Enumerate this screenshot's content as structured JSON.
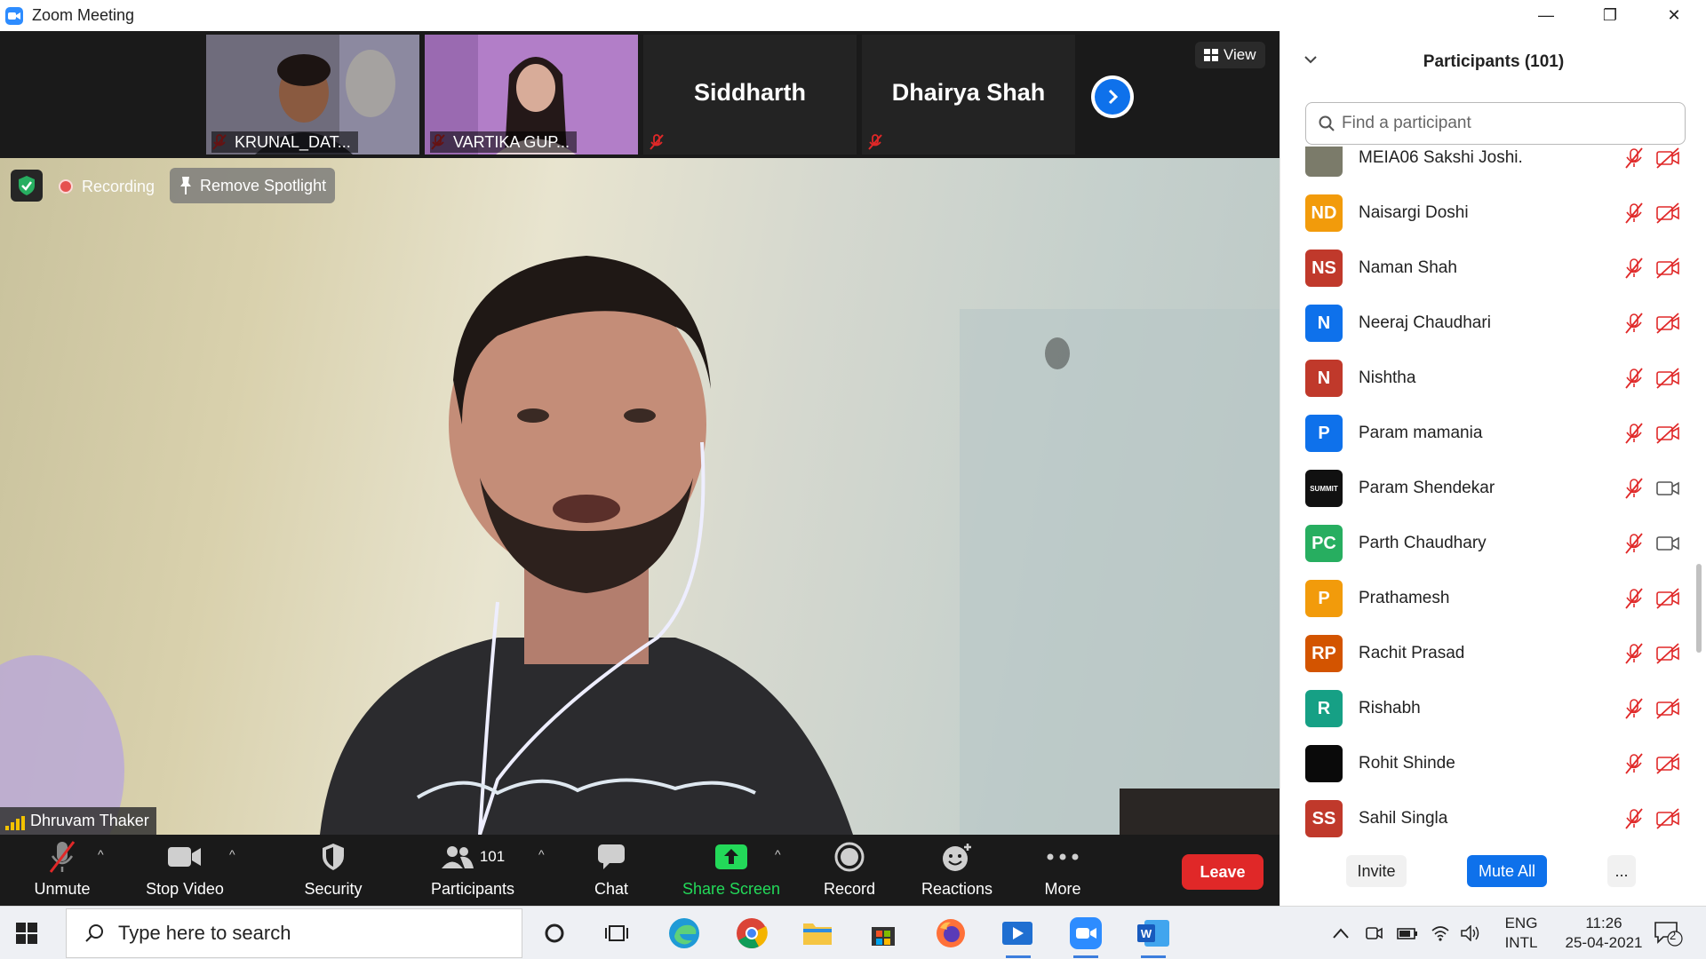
{
  "window": {
    "title": "Zoom Meeting",
    "minimize": "—",
    "restore": "❐",
    "close": "✕"
  },
  "gallery": {
    "thumbs": [
      {
        "name": "KRUNAL_DAT...",
        "muted": true
      },
      {
        "name": "VARTIKA GUP...",
        "muted": true
      },
      {
        "name": "Siddharth",
        "muted": true
      },
      {
        "name": "Dhairya Shah",
        "muted": true
      }
    ],
    "view_label": "View"
  },
  "main": {
    "recording_label": "Recording",
    "spotlight_label": "Remove Spotlight",
    "speaker_name": "Dhruvam Thaker"
  },
  "toolbar": {
    "unmute": "Unmute",
    "stop_video": "Stop Video",
    "security": "Security",
    "participants": "Participants",
    "participants_count": "101",
    "chat": "Chat",
    "share_screen": "Share Screen",
    "record": "Record",
    "reactions": "Reactions",
    "more": "More",
    "leave": "Leave"
  },
  "panel": {
    "title": "Participants (101)",
    "search_placeholder": "Find a participant",
    "participants": [
      {
        "initials": "",
        "name": "MEIA06 Sakshi Joshi.",
        "color": "#7b7b6a",
        "video_on": false
      },
      {
        "initials": "ND",
        "name": "Naisargi Doshi",
        "color": "#F29B0B",
        "video_on": false
      },
      {
        "initials": "NS",
        "name": "Naman Shah",
        "color": "#C0392B",
        "video_on": false
      },
      {
        "initials": "N",
        "name": "Neeraj Chaudhari",
        "color": "#0E71EB",
        "video_on": false
      },
      {
        "initials": "N",
        "name": "Nishtha",
        "color": "#C0392B",
        "video_on": false
      },
      {
        "initials": "P",
        "name": "Param mamania",
        "color": "#0E71EB",
        "video_on": false
      },
      {
        "initials": "SUMMIT",
        "name": "Param Shendekar",
        "color": "#111111",
        "video_on": true
      },
      {
        "initials": "PC",
        "name": "Parth Chaudhary",
        "color": "#27AE60",
        "video_on": true
      },
      {
        "initials": "P",
        "name": "Prathamesh",
        "color": "#F29B0B",
        "video_on": false
      },
      {
        "initials": "RP",
        "name": "Rachit Prasad",
        "color": "#D35400",
        "video_on": false
      },
      {
        "initials": "R",
        "name": "Rishabh",
        "color": "#16A085",
        "video_on": false
      },
      {
        "initials": "",
        "name": "Rohit Shinde",
        "color": "#0a0a0a",
        "video_on": false
      },
      {
        "initials": "SS",
        "name": "Sahil Singla",
        "color": "#C0392B",
        "video_on": false
      }
    ],
    "invite": "Invite",
    "mute_all": "Mute All",
    "more": "..."
  },
  "taskbar": {
    "search_placeholder": "Type here to search",
    "lang_top": "ENG",
    "lang_bottom": "INTL",
    "time": "11:26",
    "date": "25-04-2021",
    "notifications": "2"
  },
  "colors": {
    "accent": "#0E71EB",
    "leave": "#E02828",
    "share": "#23D959",
    "muted": "#E02828"
  }
}
